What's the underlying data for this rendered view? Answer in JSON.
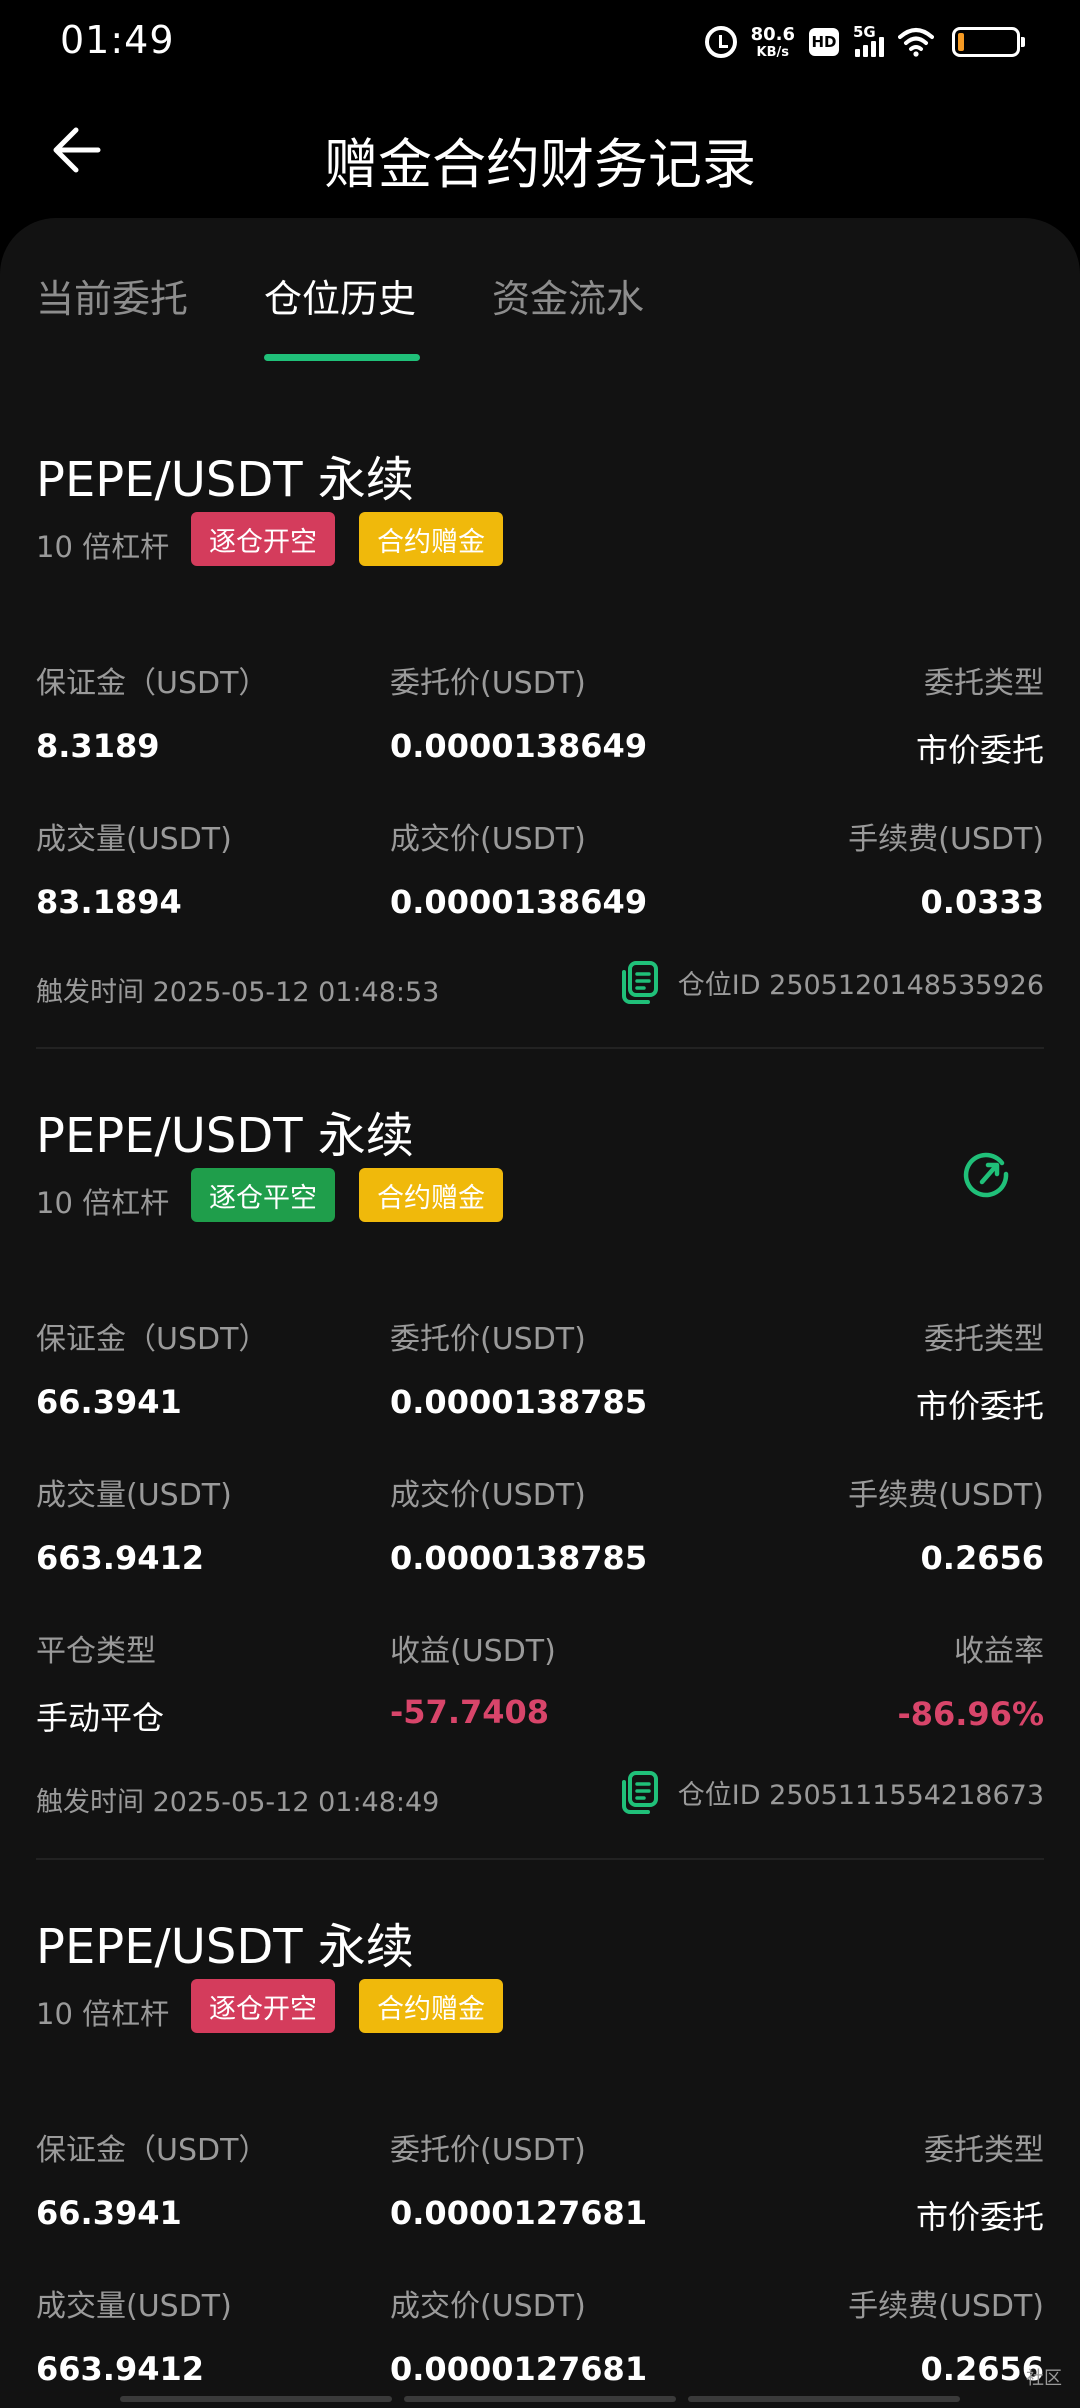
{
  "status_bar": {
    "time": "01:49",
    "net_speed_value": "80.6",
    "net_speed_unit": "KB/s",
    "hd": "HD",
    "network": "5G",
    "battery_level": 0.1
  },
  "header": {
    "title": "赠金合约财务记录"
  },
  "tabs": [
    {
      "label": "当前委托"
    },
    {
      "label": "仓位历史"
    },
    {
      "label": "资金流水"
    }
  ],
  "labels": {
    "margin": "保证金（USDT）",
    "order_price": "委托价(USDT)",
    "order_type": "委托类型",
    "volume": "成交量(USDT)",
    "fill_price": "成交价(USDT)",
    "fee": "手续费(USDT)",
    "close_type": "平仓类型",
    "pnl": "收益(USDT)",
    "pnl_rate": "收益率",
    "trigger_time": "触发时间",
    "position_id": "仓位ID"
  },
  "records": [
    {
      "title": "PEPE/USDT 永续",
      "leverage": "10 倍杠杆",
      "badge_side": "逐仓开空",
      "badge_bonus": "合约赠金",
      "margin": "8.3189",
      "order_price": "0.0000138649",
      "order_type": "市价委托",
      "volume": "83.1894",
      "fill_price": "0.0000138649",
      "fee": "0.0333",
      "trigger_time": "2025-05-12 01:48:53",
      "position_id": "2505120148535926"
    },
    {
      "title": "PEPE/USDT 永续",
      "leverage": "10 倍杠杆",
      "badge_side": "逐仓平空",
      "badge_bonus": "合约赠金",
      "margin": "66.3941",
      "order_price": "0.0000138785",
      "order_type": "市价委托",
      "volume": "663.9412",
      "fill_price": "0.0000138785",
      "fee": "0.2656",
      "close_type": "手动平仓",
      "pnl": "-57.7408",
      "pnl_rate": "-86.96%",
      "trigger_time": "2025-05-12 01:48:49",
      "position_id": "2505111554218673"
    },
    {
      "title": "PEPE/USDT 永续",
      "leverage": "10 倍杠杆",
      "badge_side": "逐仓开空",
      "badge_bonus": "合约赠金",
      "margin": "66.3941",
      "order_price": "0.0000127681",
      "order_type": "市价委托",
      "volume": "663.9412",
      "fill_price": "0.0000127681",
      "fee": "0.2656"
    }
  ],
  "watermark": "社区",
  "colors": {
    "accent": "#20c079",
    "short_badge": "#d43c5c",
    "close_badge": "#1f9e4b",
    "bonus_badge": "#f0b90b",
    "negative": "#d8456a"
  }
}
